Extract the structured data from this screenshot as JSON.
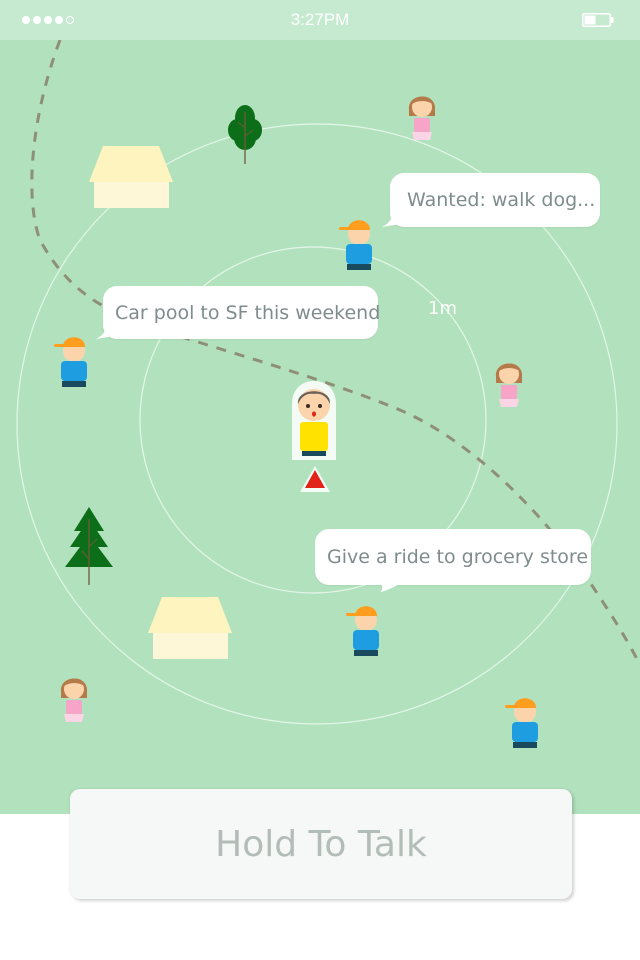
{
  "status_bar": {
    "time": "3:27PM",
    "signal_bars": 4,
    "signal_total": 5,
    "battery_level": 0.45
  },
  "map": {
    "radius_label": "1m",
    "bubbles": {
      "dog": "Wanted: walk dog...",
      "carpool": "Car pool to SF this weekend",
      "ride": "Give a ride to grocery store"
    }
  },
  "talk": {
    "label": "Hold To Talk"
  },
  "colors": {
    "map_bg": "#b2e2bd",
    "status_bg": "#c5ead0",
    "me_shirt": "#ffe200",
    "direction_arrow": "#e2231a",
    "cap": "#ff9d1e",
    "boy_shirt": "#1e9ee0",
    "girl_dress": "#f6a4c8",
    "tree": "#0d6e1a",
    "house_wall": "#fdf6d7",
    "house_roof": "#fdf4c0"
  },
  "icons": [
    "signal-icon",
    "battery-icon",
    "user-avatar-me",
    "direction-arrow-icon",
    "boy-avatar",
    "girl-avatar",
    "tree-icon",
    "pine-tree-icon",
    "house-icon"
  ]
}
